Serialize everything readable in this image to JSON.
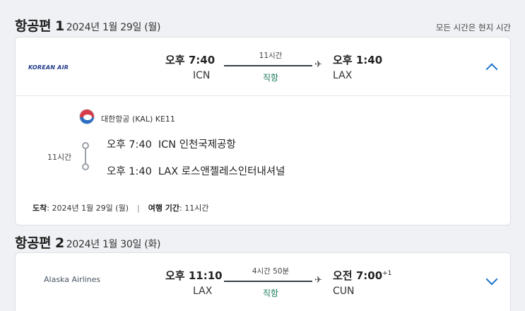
{
  "timezone_note": "모든 시간은 현지 시간",
  "flights": [
    {
      "title": "항공편 1",
      "date": "2024년 1월 29일 (월)",
      "airline_logo_text": "KOREAN AIR",
      "depart_time": "오후 7:40",
      "depart_code": "ICN",
      "duration": "11시간",
      "stops": "직항",
      "arrive_time": "오후 1:40",
      "arrive_code": "LAX",
      "expanded": true,
      "detail": {
        "airline": "대한항공 (KAL) KE11",
        "segment_duration": "11시간",
        "dep_time": "오후 7:40",
        "dep_airport": "ICN 인천국제공항",
        "arr_time": "오후 1:40",
        "arr_airport": "LAX 로스앤젤레스인터내셔널",
        "arrival_label": "도착",
        "arrival_value": ": 2024년 1월 29일 (월)",
        "separator": "|",
        "travel_time_label": "여행 기간",
        "travel_time_value": ": 11시간"
      }
    },
    {
      "title": "항공편 2",
      "date": "2024년 1월 30일 (화)",
      "airline_logo_text": "Alaska Airlines",
      "depart_time": "오후 11:10",
      "depart_code": "LAX",
      "duration": "4시간 50분",
      "stops": "직항",
      "arrive_time": "오전 7:00",
      "arrive_day_offset": "+1",
      "arrive_code": "CUN",
      "expanded": false
    }
  ],
  "icons": [
    "plane-icon",
    "chevron-up-icon",
    "chevron-down-icon",
    "korean-air-taeguk-icon"
  ],
  "colors": {
    "accent": "#1f73c9",
    "nonstop": "#1a7a57"
  }
}
